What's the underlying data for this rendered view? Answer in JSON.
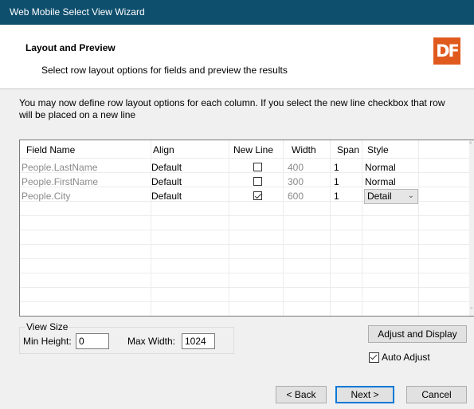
{
  "window": {
    "title": "Web Mobile Select View Wizard"
  },
  "header": {
    "title": "Layout and  Preview",
    "subtitle": "Select row layout options for fields and preview the results",
    "logo_text": "DF"
  },
  "description": "You may now define row layout options for each column. If you select the new line checkbox that row will be placed on a new line",
  "grid": {
    "columns": [
      "Field Name",
      "Align",
      "New Line",
      "Width",
      "Span",
      "Style"
    ],
    "rows": [
      {
        "field": "People.LastName",
        "align": "Default",
        "new_line": false,
        "width": "400",
        "span": "1",
        "style": "Normal"
      },
      {
        "field": "People.FirstName",
        "align": "Default",
        "new_line": false,
        "width": "300",
        "span": "1",
        "style": "Normal"
      },
      {
        "field": "People.City",
        "align": "Default",
        "new_line": true,
        "width": "600",
        "span": "1",
        "style": "Detail"
      }
    ]
  },
  "view_size": {
    "label": "View Size",
    "min_height_label": "Min Height:",
    "min_height_value": "0",
    "max_width_label": "Max Width:",
    "max_width_value": "1024"
  },
  "buttons": {
    "adjust": "Adjust and Display",
    "back": "< Back",
    "next": "Next >",
    "cancel": "Cancel"
  },
  "auto_adjust": {
    "label": "Auto Adjust",
    "checked": true
  },
  "colors": {
    "titlebar": "#0f4f6e",
    "logo": "#e05a1e",
    "focus": "#0078d7"
  },
  "icons": [
    "chevron-down-icon",
    "checkmark-icon",
    "scroll-up-icon",
    "scroll-down-icon"
  ]
}
